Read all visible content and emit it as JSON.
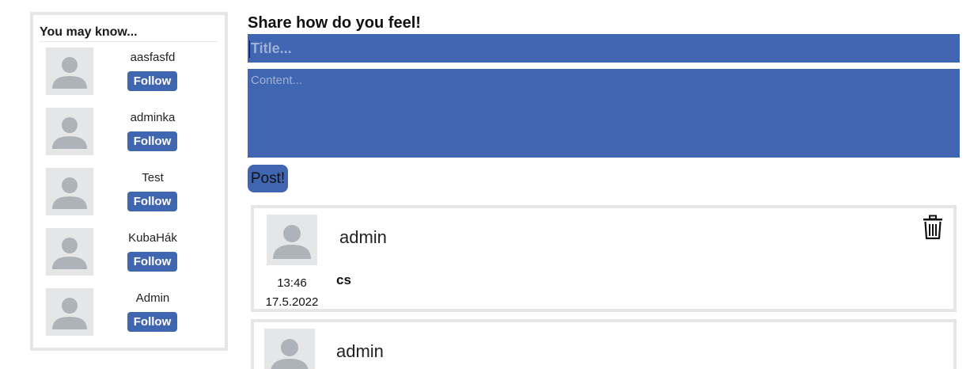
{
  "sidebar": {
    "title": "You may know...",
    "people": [
      {
        "name": "aasfasfd",
        "follow_label": "Follow"
      },
      {
        "name": "adminka",
        "follow_label": "Follow"
      },
      {
        "name": "Test",
        "follow_label": "Follow"
      },
      {
        "name": "KubaHák",
        "follow_label": "Follow"
      },
      {
        "name": "Admin",
        "follow_label": "Follow"
      }
    ]
  },
  "composer": {
    "heading": "Share how do you feel!",
    "title_placeholder": "Title...",
    "content_placeholder": "Content...",
    "post_label": "Post!"
  },
  "posts": [
    {
      "author": "admin",
      "time": "13:46",
      "date": "17.5.2022",
      "title": "cs"
    },
    {
      "author": "admin"
    }
  ],
  "colors": {
    "accent": "#4166b1",
    "border": "#e6e6e6",
    "avatar_bg": "#e5e6e8",
    "avatar_fg": "#aeb3b9"
  },
  "icons": {
    "avatar": "default-user-avatar",
    "delete": "trash-icon"
  }
}
